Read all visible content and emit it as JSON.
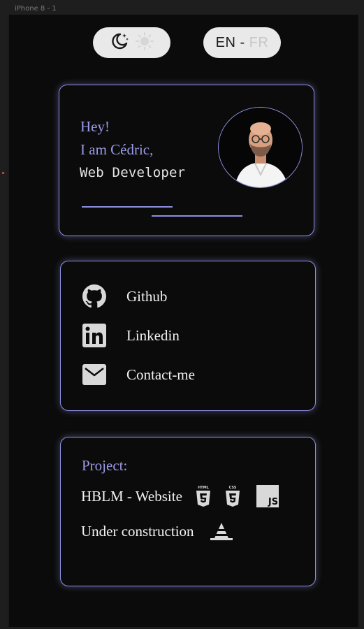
{
  "frame": {
    "label": "iPhone 8 - 1"
  },
  "toggles": {
    "language": {
      "en": "EN",
      "separator": "-",
      "fr": "FR"
    },
    "theme": {
      "dark_icon": "moon-icon",
      "light_icon": "sun-icon"
    }
  },
  "intro": {
    "greeting": "Hey!",
    "name_line": "I am Cédric,",
    "role": "Web Developer",
    "avatar": "avatar"
  },
  "links": [
    {
      "label": "Github",
      "icon": "github-icon"
    },
    {
      "label": "Linkedin",
      "icon": "linkedin-icon"
    },
    {
      "label": "Contact-me",
      "icon": "mail-icon"
    }
  ],
  "project": {
    "title": "Project:",
    "items": [
      {
        "label": "HBLM - Website",
        "tech": [
          "html5-icon",
          "css3-icon",
          "js-icon"
        ]
      },
      {
        "label": "Under construction",
        "tech": [
          "construction-icon"
        ]
      }
    ],
    "tech_badges": {
      "html": "HTML",
      "css": "CSS",
      "js": "JS"
    }
  },
  "colors": {
    "accent": "#8d8ee0",
    "background": "#0b0b0b",
    "toggle_bg": "#e9e9ea",
    "text": "#f0f0f0"
  }
}
